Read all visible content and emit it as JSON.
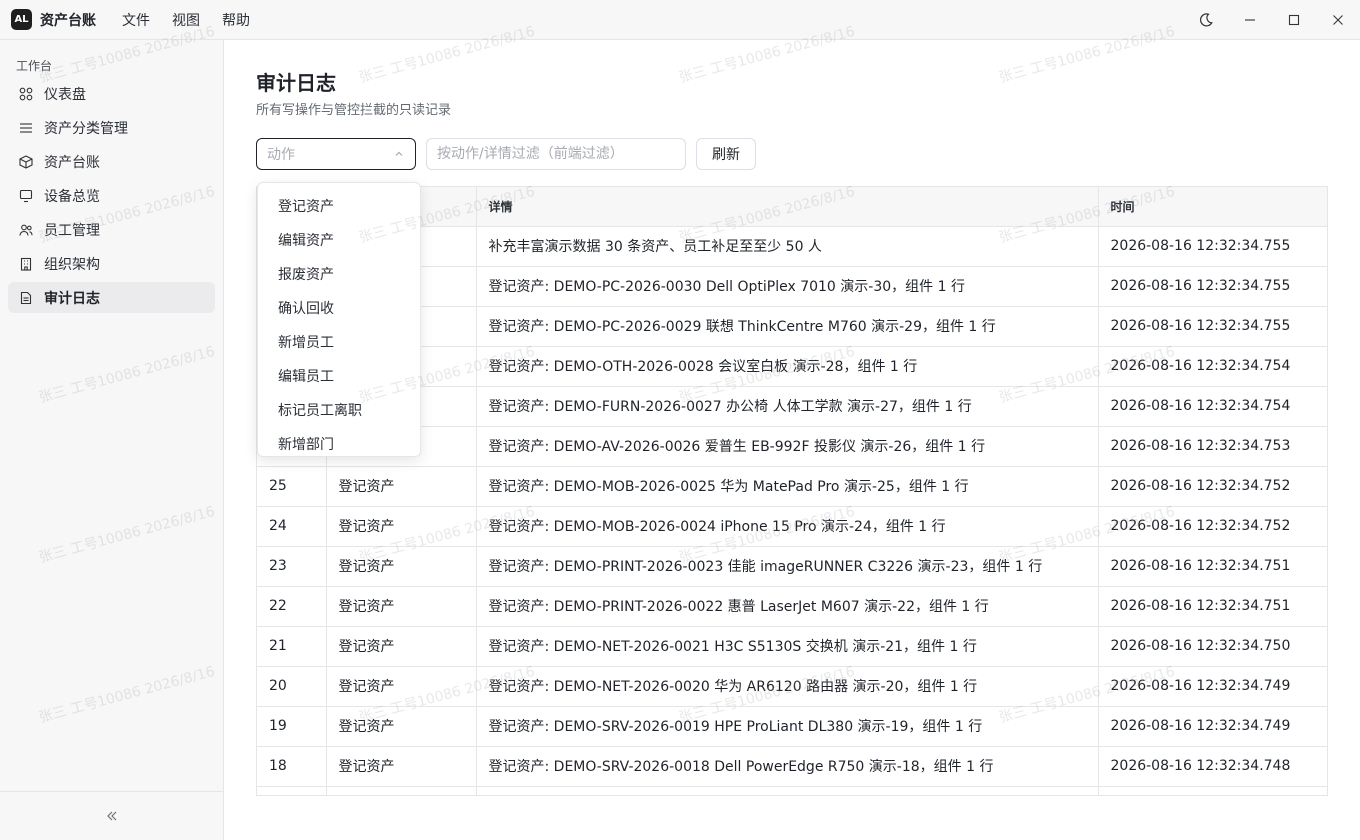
{
  "titlebar": {
    "logo": "AL",
    "app_name": "资产台账",
    "menu": [
      "文件",
      "视图",
      "帮助"
    ]
  },
  "sidebar": {
    "section_label": "工作台",
    "items": [
      {
        "label": "仪表盘",
        "icon": "grid-icon"
      },
      {
        "label": "资产分类管理",
        "icon": "list-icon"
      },
      {
        "label": "资产台账",
        "icon": "box-icon"
      },
      {
        "label": "设备总览",
        "icon": "monitor-icon"
      },
      {
        "label": "员工管理",
        "icon": "users-icon"
      },
      {
        "label": "组织架构",
        "icon": "building-icon"
      },
      {
        "label": "审计日志",
        "icon": "document-icon",
        "active": true
      }
    ],
    "collapse_icon": "chevrons-left-icon"
  },
  "page": {
    "title": "审计日志",
    "subtitle": "所有写操作与管控拦截的只读记录"
  },
  "toolbar": {
    "action_placeholder": "动作",
    "filter_placeholder": "按动作/详情过滤（前端过滤）",
    "refresh_label": "刷新"
  },
  "dropdown": {
    "options": [
      "登记资产",
      "编辑资产",
      "报废资产",
      "确认回收",
      "新增员工",
      "编辑员工",
      "标记员工离职",
      "新增部门"
    ]
  },
  "table": {
    "columns": [
      "",
      "",
      "详情",
      "时间"
    ],
    "rows": [
      {
        "id": "",
        "action": "",
        "detail": "补充丰富演示数据 30 条资产、员工补足至至少 50 人",
        "time": "2026-08-16 12:32:34.755"
      },
      {
        "id": "",
        "action": "",
        "detail": "登记资产: DEMO-PC-2026-0030 Dell OptiPlex 7010 演示-30，组件 1 行",
        "time": "2026-08-16 12:32:34.755"
      },
      {
        "id": "",
        "action": "",
        "detail": "登记资产: DEMO-PC-2026-0029 联想 ThinkCentre M760 演示-29，组件 1 行",
        "time": "2026-08-16 12:32:34.755"
      },
      {
        "id": "",
        "action": "",
        "detail": "登记资产: DEMO-OTH-2026-0028 会议室白板 演示-28，组件 1 行",
        "time": "2026-08-16 12:32:34.754"
      },
      {
        "id": "",
        "action": "",
        "detail": "登记资产: DEMO-FURN-2026-0027 办公椅 人体工学款 演示-27，组件 1 行",
        "time": "2026-08-16 12:32:34.754"
      },
      {
        "id": "",
        "action": "",
        "detail": "登记资产: DEMO-AV-2026-0026 爱普生 EB-992F 投影仪 演示-26，组件 1 行",
        "time": "2026-08-16 12:32:34.753"
      },
      {
        "id": "25",
        "action": "登记资产",
        "detail": "登记资产: DEMO-MOB-2026-0025 华为 MatePad Pro 演示-25，组件 1 行",
        "time": "2026-08-16 12:32:34.752"
      },
      {
        "id": "24",
        "action": "登记资产",
        "detail": "登记资产: DEMO-MOB-2026-0024 iPhone 15 Pro 演示-24，组件 1 行",
        "time": "2026-08-16 12:32:34.752"
      },
      {
        "id": "23",
        "action": "登记资产",
        "detail": "登记资产: DEMO-PRINT-2026-0023 佳能 imageRUNNER C3226 演示-23，组件 1 行",
        "time": "2026-08-16 12:32:34.751"
      },
      {
        "id": "22",
        "action": "登记资产",
        "detail": "登记资产: DEMO-PRINT-2026-0022 惠普 LaserJet M607 演示-22，组件 1 行",
        "time": "2026-08-16 12:32:34.751"
      },
      {
        "id": "21",
        "action": "登记资产",
        "detail": "登记资产: DEMO-NET-2026-0021 H3C S5130S 交换机 演示-21，组件 1 行",
        "time": "2026-08-16 12:32:34.750"
      },
      {
        "id": "20",
        "action": "登记资产",
        "detail": "登记资产: DEMO-NET-2026-0020 华为 AR6120 路由器 演示-20，组件 1 行",
        "time": "2026-08-16 12:32:34.749"
      },
      {
        "id": "19",
        "action": "登记资产",
        "detail": "登记资产: DEMO-SRV-2026-0019 HPE ProLiant DL380 演示-19，组件 1 行",
        "time": "2026-08-16 12:32:34.749"
      },
      {
        "id": "18",
        "action": "登记资产",
        "detail": "登记资产: DEMO-SRV-2026-0018 Dell PowerEdge R750 演示-18，组件 1 行",
        "time": "2026-08-16 12:32:34.748"
      },
      {
        "id": "",
        "action": "",
        "detail": "",
        "time": ""
      }
    ]
  },
  "watermark": {
    "text": "张三 工号10086 2026/8/16"
  }
}
